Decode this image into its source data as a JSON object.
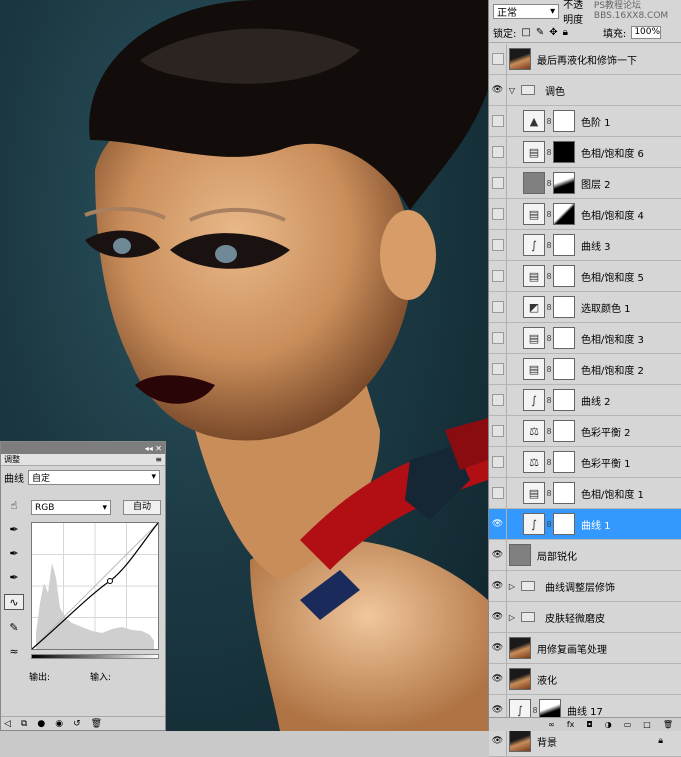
{
  "layers_panel": {
    "blend_mode": "正常",
    "opacity_label": "不透明度",
    "watermark": "PS教程论坛 BBS.16XX8.COM",
    "lock_label": "锁定:",
    "fill_label": "填充:",
    "fill_value": "100%",
    "layers": [
      {
        "name": "最后再液化和修饰一下",
        "type": "photo",
        "visible": false
      },
      {
        "name": "调色",
        "type": "group-open",
        "visible": true
      },
      {
        "name": "色阶 1",
        "type": "levels",
        "mask": "white",
        "visible": false,
        "indent": true
      },
      {
        "name": "色相/饱和度 6",
        "type": "huesat",
        "mask": "black",
        "visible": false,
        "indent": true
      },
      {
        "name": "图层 2",
        "type": "gray",
        "mask": "photo",
        "visible": false,
        "indent": true
      },
      {
        "name": "色相/饱和度 4",
        "type": "huesat",
        "mask": "mix",
        "visible": false,
        "indent": true
      },
      {
        "name": "曲线 3",
        "type": "curves",
        "mask": "white",
        "visible": false,
        "indent": true
      },
      {
        "name": "色相/饱和度 5",
        "type": "huesat",
        "mask": "white",
        "visible": false,
        "indent": true
      },
      {
        "name": "选取颜色 1",
        "type": "selcolor",
        "mask": "white",
        "visible": false,
        "indent": true
      },
      {
        "name": "色相/饱和度 3",
        "type": "huesat",
        "mask": "white",
        "visible": false,
        "indent": true
      },
      {
        "name": "色相/饱和度 2",
        "type": "huesat",
        "mask": "white",
        "visible": false,
        "indent": true
      },
      {
        "name": "曲线 2",
        "type": "curves",
        "mask": "white",
        "visible": false,
        "indent": true
      },
      {
        "name": "色彩平衡 2",
        "type": "balance",
        "mask": "white",
        "visible": false,
        "indent": true
      },
      {
        "name": "色彩平衡 1",
        "type": "balance",
        "mask": "white",
        "visible": false,
        "indent": true
      },
      {
        "name": "色相/饱和度 1",
        "type": "huesat",
        "mask": "white",
        "visible": false,
        "indent": true
      },
      {
        "name": "曲线 1",
        "type": "curves",
        "mask": "white",
        "visible": true,
        "indent": true,
        "selected": true
      },
      {
        "name": "局部锐化",
        "type": "gray",
        "visible": true
      },
      {
        "name": "曲线调整层修饰",
        "type": "group",
        "visible": true
      },
      {
        "name": "皮肤轻微磨皮",
        "type": "group",
        "visible": true
      },
      {
        "name": "用修复画笔处理",
        "type": "photo",
        "visible": true
      },
      {
        "name": "液化",
        "type": "photo",
        "visible": true
      },
      {
        "name": "曲线 17",
        "type": "curves",
        "mask": "photo",
        "visible": true
      },
      {
        "name": "背景",
        "type": "photo",
        "visible": true,
        "locked": true
      }
    ]
  },
  "adjustments_panel": {
    "tab_title": "调整",
    "curve_label": "曲线",
    "preset_value": "自定",
    "channel_value": "RGB",
    "auto_label": "自动",
    "output_label": "输出:",
    "input_label": "输入:"
  }
}
